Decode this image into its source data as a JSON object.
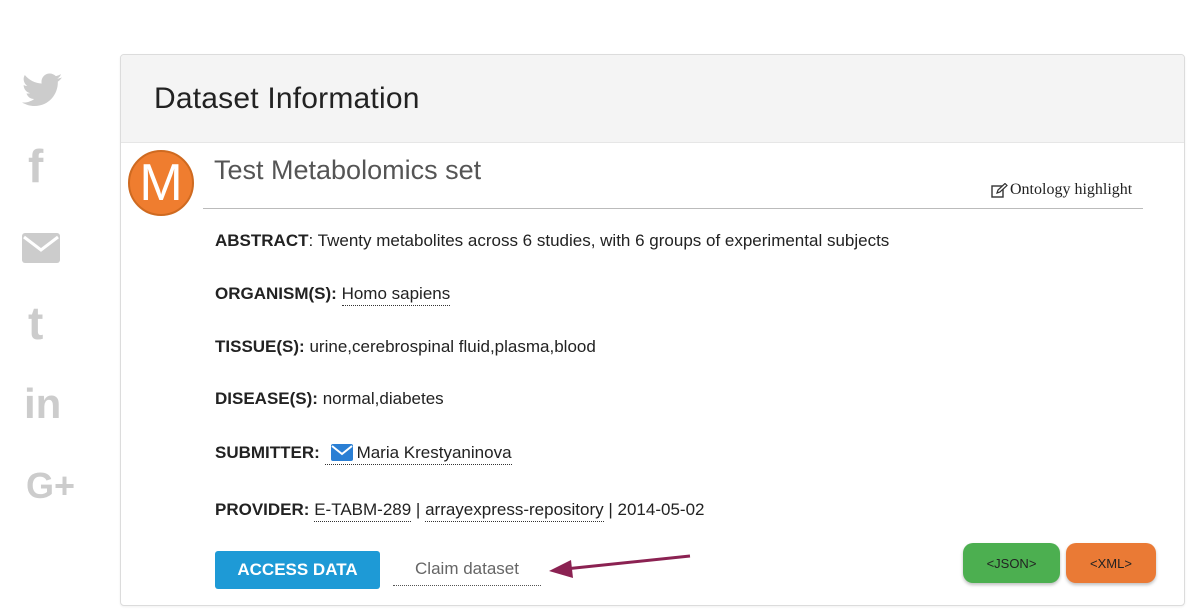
{
  "social": {
    "icons": [
      "twitter-icon",
      "facebook-icon",
      "email-icon",
      "tumblr-icon",
      "linkedin-icon",
      "google-plus-icon"
    ],
    "facebook_glyph": "f",
    "tumblr_glyph": "t",
    "linkedin_glyph": "in",
    "googleplus_glyph": "G+",
    "color": "#cccccc"
  },
  "panel": {
    "heading": "Dataset Information",
    "avatar_letter": "M",
    "avatar_color": "#ef7d2f",
    "dataset_title": "Test Metabolomics set",
    "ontology_label": "Ontology highlight"
  },
  "fields": {
    "abstract_label": "ABSTRACT",
    "abstract_value": ": Twenty metabolites across 6 studies, with 6 groups of experimental subjects",
    "organism_label": "ORGANISM(S):",
    "organism_value": "Homo sapiens",
    "tissue_label": "TISSUE(S):",
    "tissue_value": "urine,cerebrospinal fluid,plasma,blood",
    "disease_label": "DISEASE(S):",
    "disease_value": "normal,diabetes",
    "submitter_label": "SUBMITTER:",
    "submitter_value": "Maria Krestyaninova",
    "provider_label": "PROVIDER:",
    "provider_accession": "E-TABM-289",
    "provider_sep1": " | ",
    "provider_repo": "arrayexpress-repository",
    "provider_sep2": " | ",
    "provider_date": "2014-05-02"
  },
  "actions": {
    "access_label": "ACCESS DATA",
    "claim_label": "Claim dataset",
    "json_label": "<JSON>",
    "xml_label": "<XML>",
    "access_color": "#1e9ad6",
    "json_color": "#4caf50",
    "xml_color": "#ea7a35",
    "arrow_color": "#8b2252"
  }
}
